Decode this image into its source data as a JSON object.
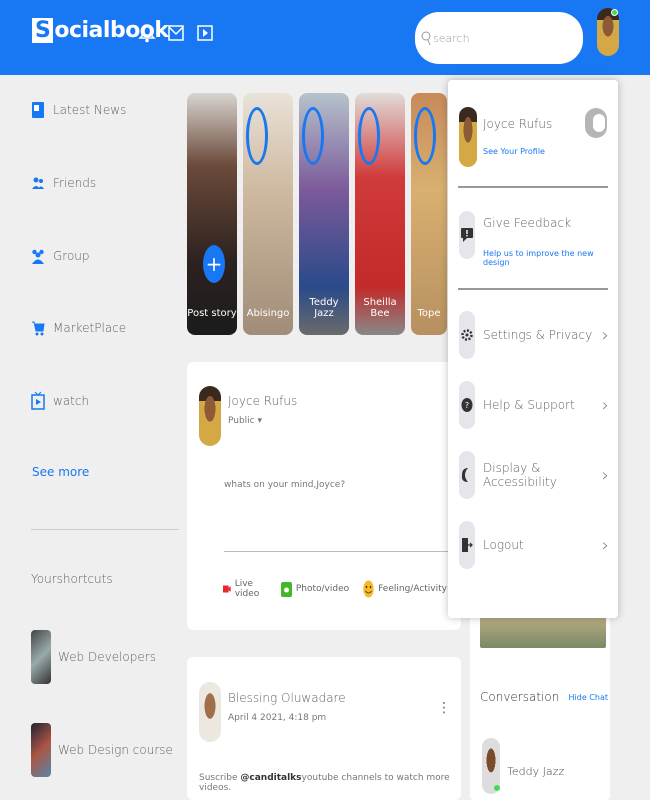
{
  "nav": {
    "logo": "Socialbook",
    "logo_first": "S",
    "logo_rest": "ocialbook",
    "search_placeholder": "search"
  },
  "sidebar": {
    "items": [
      {
        "label": "Latest News",
        "icon": "news-icon"
      },
      {
        "label": "Friends",
        "icon": "friends-icon"
      },
      {
        "label": "Group",
        "icon": "group-icon"
      },
      {
        "label": "MarketPlace",
        "icon": "cart-icon"
      },
      {
        "label": "watch",
        "icon": "tv-icon"
      }
    ],
    "see_more": "See more",
    "shortcuts_title": "Yourshortcuts",
    "shortcuts": [
      "Web Developers",
      "Web Design course"
    ]
  },
  "stories": {
    "items": [
      {
        "name": "Post story",
        "is_add": true
      },
      {
        "name": "Abisingo"
      },
      {
        "name": "Teddy Jazz"
      },
      {
        "name": "Sheilla Bee"
      },
      {
        "name": "Tope"
      }
    ]
  },
  "composer": {
    "user": "Joyce Rufus",
    "privacy": "Public ▾",
    "placeholder": "whats on your mind,Joyce?",
    "actions": [
      {
        "label": "Live video",
        "icon": "live-video-icon"
      },
      {
        "label": "Photo/video",
        "icon": "photo-icon"
      },
      {
        "label": "Feeling/Activity",
        "icon": "feeling-icon"
      }
    ]
  },
  "post": {
    "user": "Blessing Oluwadare",
    "date": "April 4 2021, 4:18 pm",
    "text_before": "Suscribe ",
    "handle": "@canditalks",
    "text_after": "youtube channels to watch more videos."
  },
  "right": {
    "conversation": "Conversation",
    "hide_chat": "Hide Chat",
    "contact": "Teddy Jazz"
  },
  "menu": {
    "name": "Joyce Rufus",
    "profile_link": "See Your Profile",
    "feedback_title": "Give Feedback",
    "feedback_sub": "Help us to improve the new design",
    "items": [
      "Settings & Privacy",
      "Help & Support",
      "Display & Accessibility",
      "Logout"
    ],
    "chevron": "›"
  },
  "colors": {
    "primary": "#1877f2",
    "online": "#41db51",
    "background": "#efefef"
  }
}
